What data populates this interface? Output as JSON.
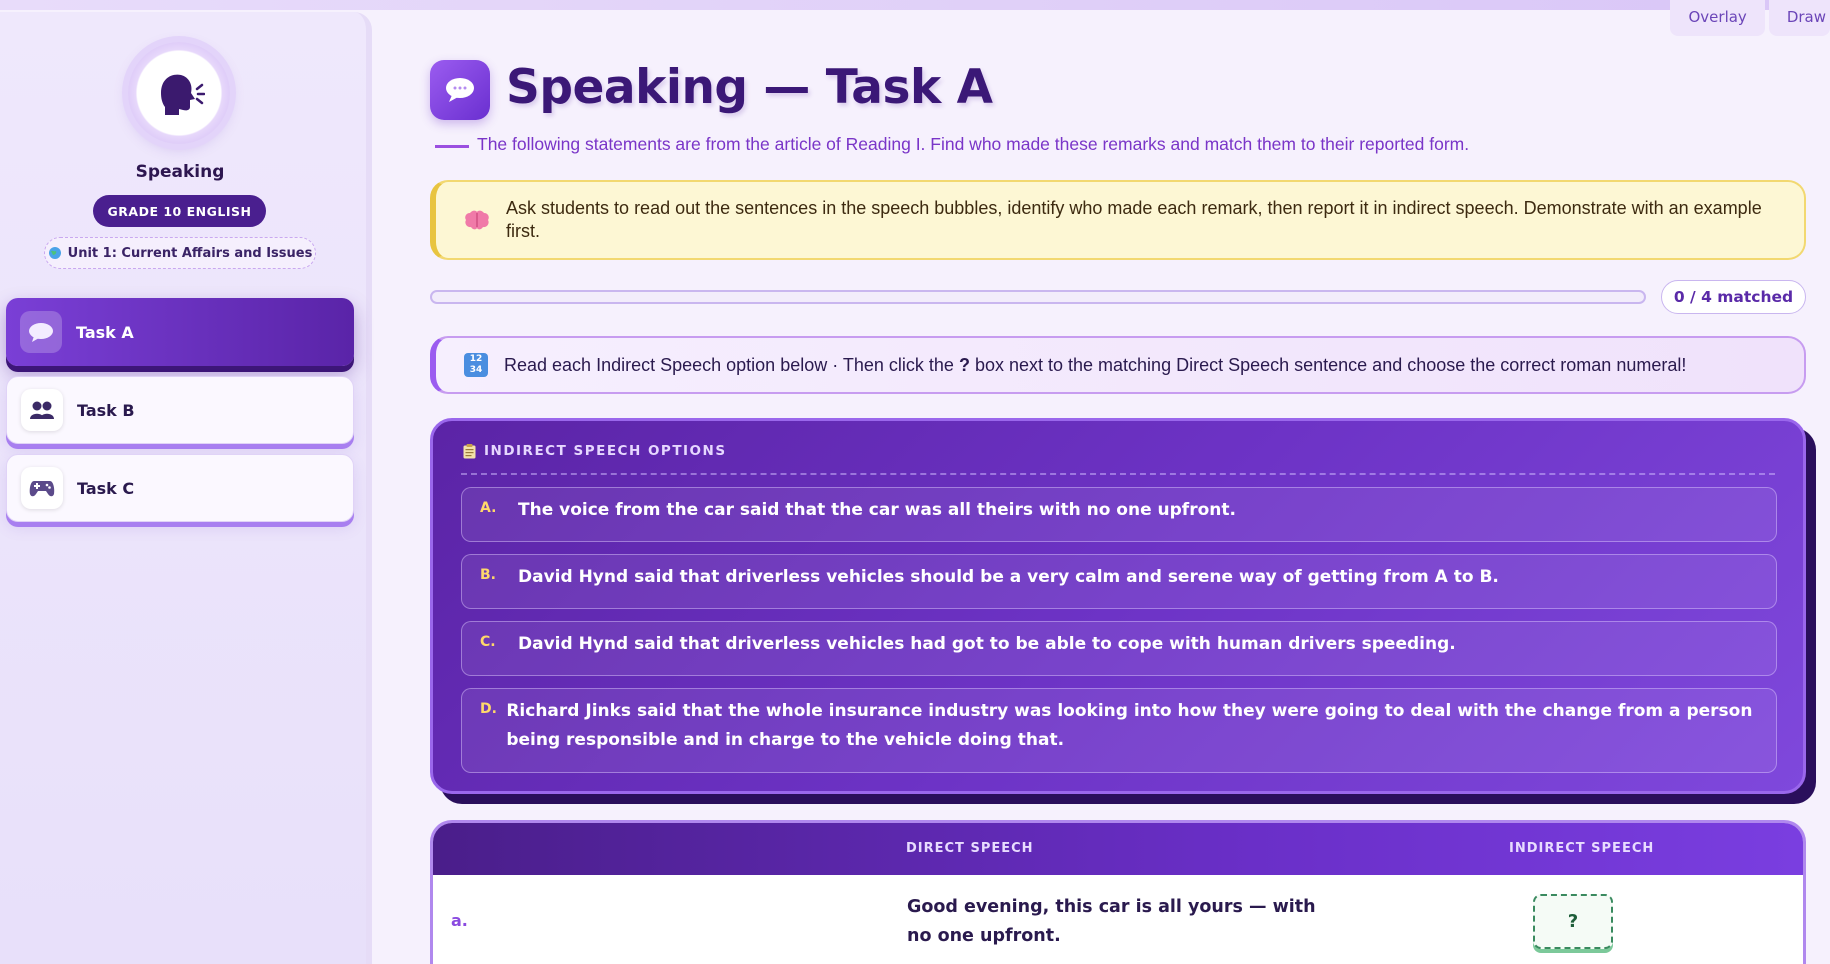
{
  "topbar": {
    "buttons": [
      "Overlay",
      "Draw"
    ]
  },
  "sidebar": {
    "title": "Speaking",
    "grade": "GRADE 10 ENGLISH",
    "unit": "Unit 1: Current Affairs and Issues",
    "items": [
      {
        "label": "Task A",
        "icon": "speech-bubble-icon",
        "active": true
      },
      {
        "label": "Task B",
        "icon": "people-icon",
        "active": false
      },
      {
        "label": "Task C",
        "icon": "gamepad-icon",
        "active": false
      }
    ]
  },
  "main": {
    "title": "Speaking — Task A",
    "subtitle": "The following statements are from the article of Reading I. Find who made these remarks and match them to their reported form.",
    "teacher_note": "Ask students to read out the sentences in the speech bubbles, identify who made each remark, then report it in indirect speech. Demonstrate with an example first.",
    "progress": {
      "fraction": 0.0,
      "label": "0 / 4 matched"
    },
    "instruction": {
      "before": "Read each Indirect Speech option below · Then click the ",
      "bold": "?",
      "after": " box next to the matching Direct Speech sentence and choose the correct roman numeral!"
    },
    "options_header": "INDIRECT SPEECH OPTIONS",
    "options": [
      {
        "letter": "A.",
        "text": "The voice from the car said that the car was all theirs with no one upfront."
      },
      {
        "letter": "B.",
        "text": "David Hynd said that driverless vehicles should be a very calm and serene way of getting from A to B."
      },
      {
        "letter": "C.",
        "text": "David Hynd said that driverless vehicles had got to be able to cope with human drivers speeding."
      },
      {
        "letter": "D.",
        "text": "Richard Jinks said that the whole insurance industry was looking into how they were going to deal with the change from a person being responsible and in charge to the vehicle doing that."
      }
    ],
    "table": {
      "headers": {
        "direct": "DIRECT SPEECH",
        "indirect": "INDIRECT SPEECH"
      },
      "rows": [
        {
          "label": "a.",
          "direct": "Good evening, this car is all yours — with no one upfront.",
          "slot": "?"
        }
      ]
    }
  },
  "colors": {
    "accent": "#6a2fd0",
    "note_bg": "#fdf7d4",
    "slot_border": "#3a8a5f"
  }
}
